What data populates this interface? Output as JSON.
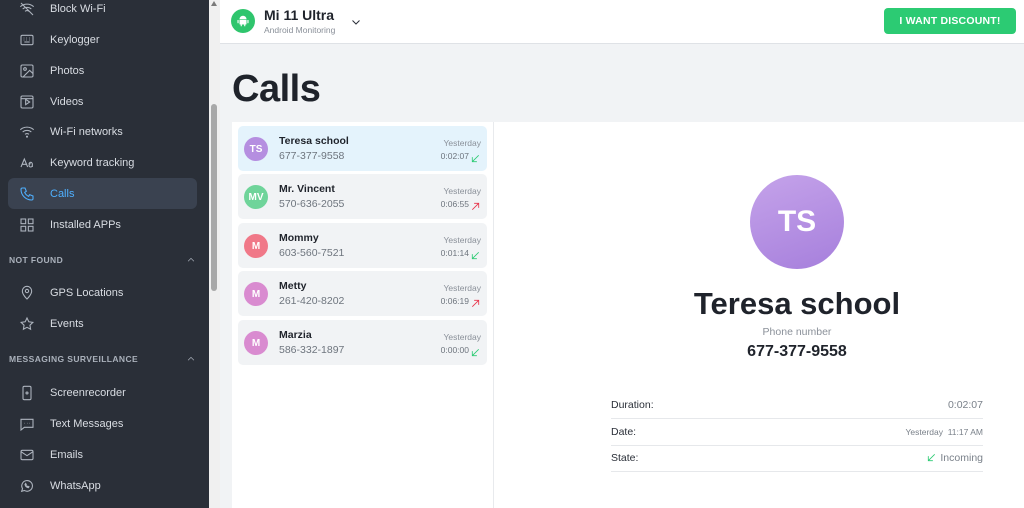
{
  "sidebar": {
    "items": [
      {
        "label": "Block Wi-Fi",
        "icon": "wifi-off-icon"
      },
      {
        "label": "Keylogger",
        "icon": "keyboard-icon"
      },
      {
        "label": "Photos",
        "icon": "image-icon"
      },
      {
        "label": "Videos",
        "icon": "video-icon"
      },
      {
        "label": "Wi-Fi networks",
        "icon": "wifi-icon"
      },
      {
        "label": "Keyword tracking",
        "icon": "text-aa-icon"
      },
      {
        "label": "Calls",
        "icon": "phone-icon",
        "active": true
      },
      {
        "label": "Installed APPs",
        "icon": "apps-grid-icon"
      }
    ],
    "section_not_found": {
      "title": "NOT FOUND",
      "items": [
        {
          "label": "GPS Locations",
          "icon": "location-pin-icon"
        },
        {
          "label": "Events",
          "icon": "star-icon"
        }
      ]
    },
    "section_messaging": {
      "title": "MESSAGING SURVEILLANCE",
      "items": [
        {
          "label": "Screenrecorder",
          "icon": "screen-record-icon"
        },
        {
          "label": "Text Messages",
          "icon": "message-icon"
        },
        {
          "label": "Emails",
          "icon": "mail-icon"
        },
        {
          "label": "WhatsApp",
          "icon": "whatsapp-icon"
        }
      ]
    }
  },
  "header": {
    "device_name": "Mi 11 Ultra",
    "device_subtitle": "Android Monitoring",
    "discount_label": "I WANT DISCOUNT!"
  },
  "page": {
    "title": "Calls"
  },
  "calls": [
    {
      "initials": "TS",
      "name": "Teresa school",
      "phone": "677-377-9558",
      "when": "Yesterday",
      "duration": "0:02:07",
      "direction": "incoming",
      "avatar_color": "#b58ee0",
      "active": true
    },
    {
      "initials": "MV",
      "name": "Mr. Vincent",
      "phone": "570-636-2055",
      "when": "Yesterday",
      "duration": "0:06:55",
      "direction": "outgoing",
      "avatar_color": "#6fd49a"
    },
    {
      "initials": "M",
      "name": "Mommy",
      "phone": "603-560-7521",
      "when": "Yesterday",
      "duration": "0:01:14",
      "direction": "incoming",
      "avatar_color": "#f07888"
    },
    {
      "initials": "M",
      "name": "Metty",
      "phone": "261-420-8202",
      "when": "Yesterday",
      "duration": "0:06:19",
      "direction": "outgoing",
      "avatar_color": "#d98bd0"
    },
    {
      "initials": "M",
      "name": "Marzia",
      "phone": "586-332-1897",
      "when": "Yesterday",
      "duration": "0:00:00",
      "direction": "incoming",
      "avatar_color": "#d98bd0"
    }
  ],
  "detail": {
    "initials": "TS",
    "name": "Teresa school",
    "phone_label": "Phone number",
    "phone": "677-377-9558",
    "duration_label": "Duration:",
    "duration": "0:02:07",
    "date_label": "Date:",
    "date": "Yesterday  11:17 AM",
    "state_label": "State:",
    "state": "Incoming"
  },
  "colors": {
    "sidebar_bg": "#2a2f38",
    "accent_blue": "#4fb0ff",
    "accent_green": "#2ccb73",
    "outgoing_red": "#e8334a"
  }
}
